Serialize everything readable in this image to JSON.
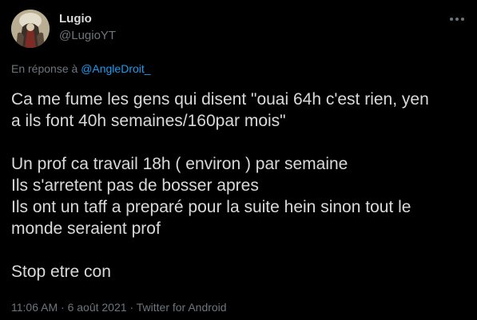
{
  "author": {
    "name": "Lugio",
    "handle": "@LugioYT"
  },
  "reply": {
    "prefix": "En réponse à",
    "mention": "@AngleDroit_"
  },
  "tweet": {
    "lines": [
      "Ca me fume les gens qui disent \"ouai 64h c'est rien, yen",
      "a ils font 40h semaines/160par mois\"",
      "",
      "Un prof ca travail 18h ( environ ) par semaine",
      "Ils s'arretent pas de bosser apres",
      "Ils ont un taff a preparé pour la suite hein sinon tout le",
      "monde seraient prof",
      "",
      "Stop etre con"
    ]
  },
  "meta": {
    "time": "11:06 AM",
    "separator": "·",
    "date": "6 août 2021",
    "source": "Twitter for Android"
  },
  "icons": {
    "more": "more-horizontal-icon",
    "avatar": "avatar"
  },
  "colors": {
    "background": "#000000",
    "text": "#d9d9d9",
    "secondary": "#6e767d",
    "link": "#1d9bf0"
  }
}
